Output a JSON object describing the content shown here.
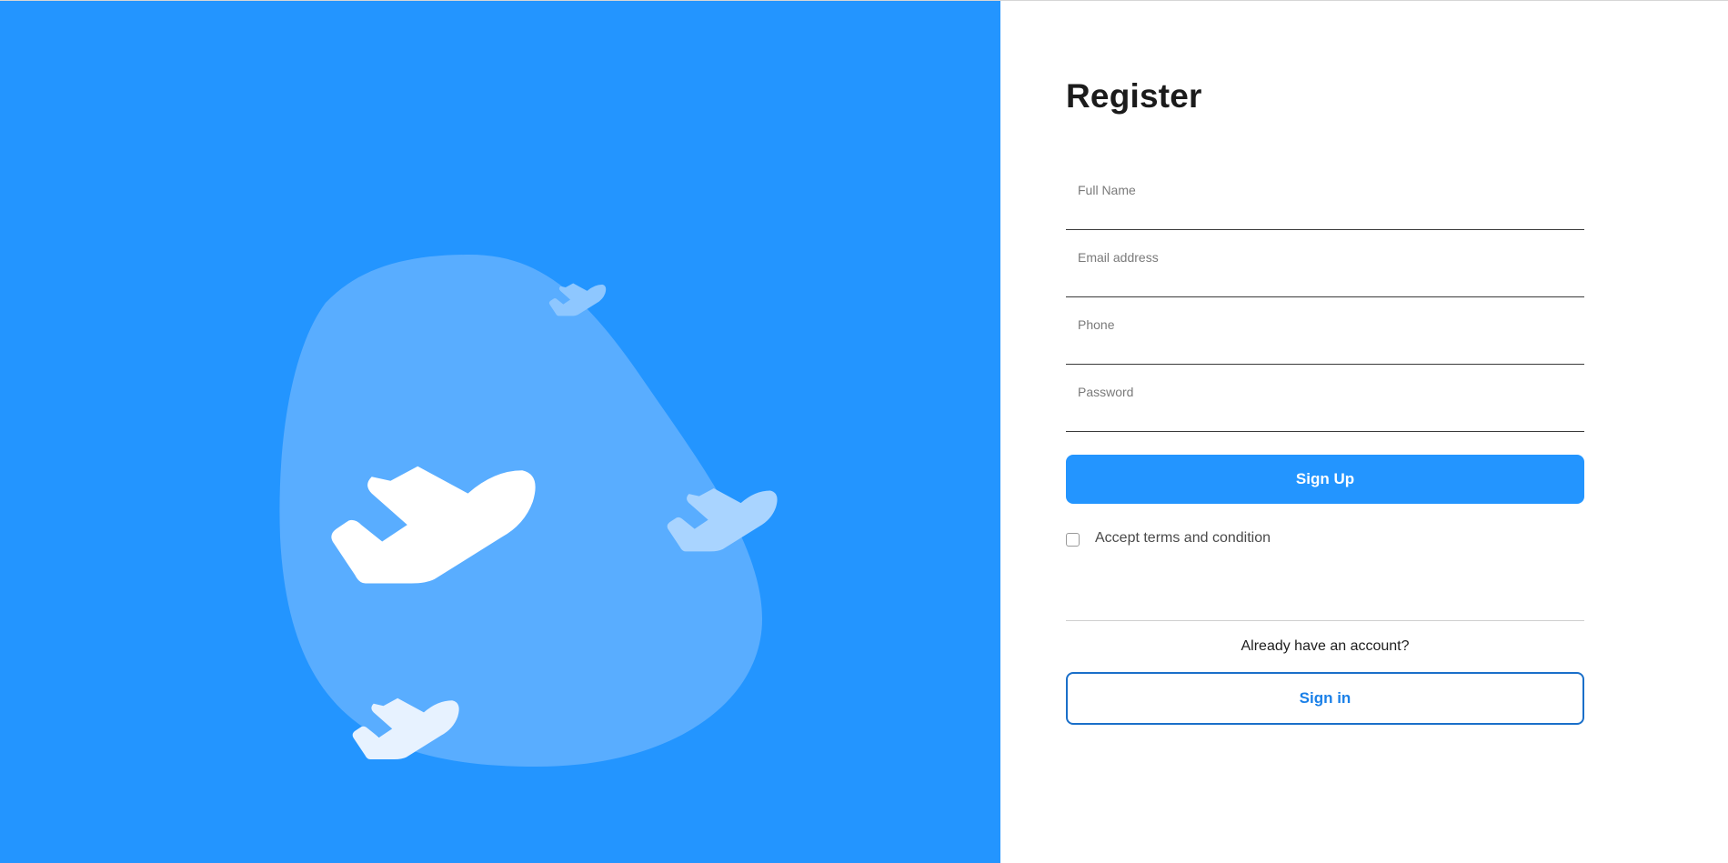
{
  "register": {
    "title": "Register",
    "fields": [
      {
        "placeholder": "Full Name",
        "value": ""
      },
      {
        "placeholder": "Email address",
        "value": ""
      },
      {
        "placeholder": "Phone",
        "value": ""
      },
      {
        "placeholder": "Password",
        "value": ""
      }
    ],
    "submit_label": "Sign Up",
    "terms_label": "Accept terms and condition",
    "terms_checked": false,
    "already_text": "Already have an account?",
    "signin_label": "Sign in"
  },
  "icons": {
    "hero_main": "airplane-icon",
    "hero_small": "airplane-icon"
  },
  "colors": {
    "brand": "#2395ff",
    "blob": "#59adff",
    "outline_border": "#1a6fc9",
    "outline_text": "#1a80e8"
  }
}
